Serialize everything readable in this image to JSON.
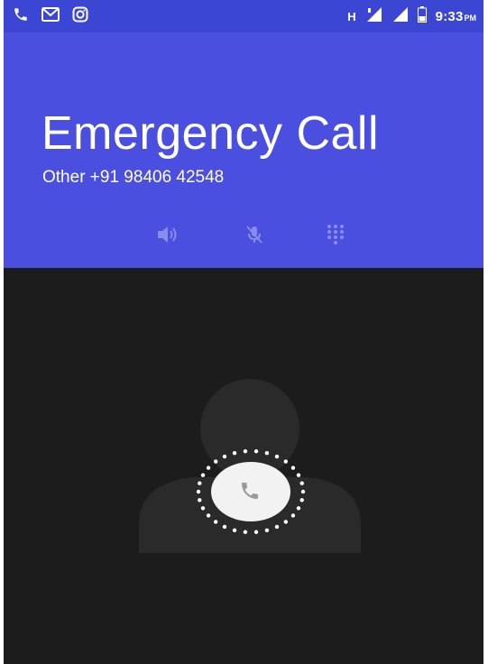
{
  "status_bar": {
    "left_icons": [
      "phone-icon",
      "gmail-icon",
      "instagram-icon"
    ],
    "network_label": "H",
    "time": "9:33",
    "ampm": "PM",
    "bar_color": "#3b46d3"
  },
  "call": {
    "title": "Emergency Call",
    "subtitle": "Other +91 98406 42548",
    "header_color": "#4a4fdf"
  },
  "actions": [
    {
      "name": "speaker-button",
      "icon": "speaker-icon"
    },
    {
      "name": "mute-button",
      "icon": "mic-off-icon"
    },
    {
      "name": "dialpad-button",
      "icon": "dialpad-icon"
    }
  ],
  "incoming": {
    "answer_icon": "phone-icon",
    "background_color": "#1c1c1c"
  }
}
